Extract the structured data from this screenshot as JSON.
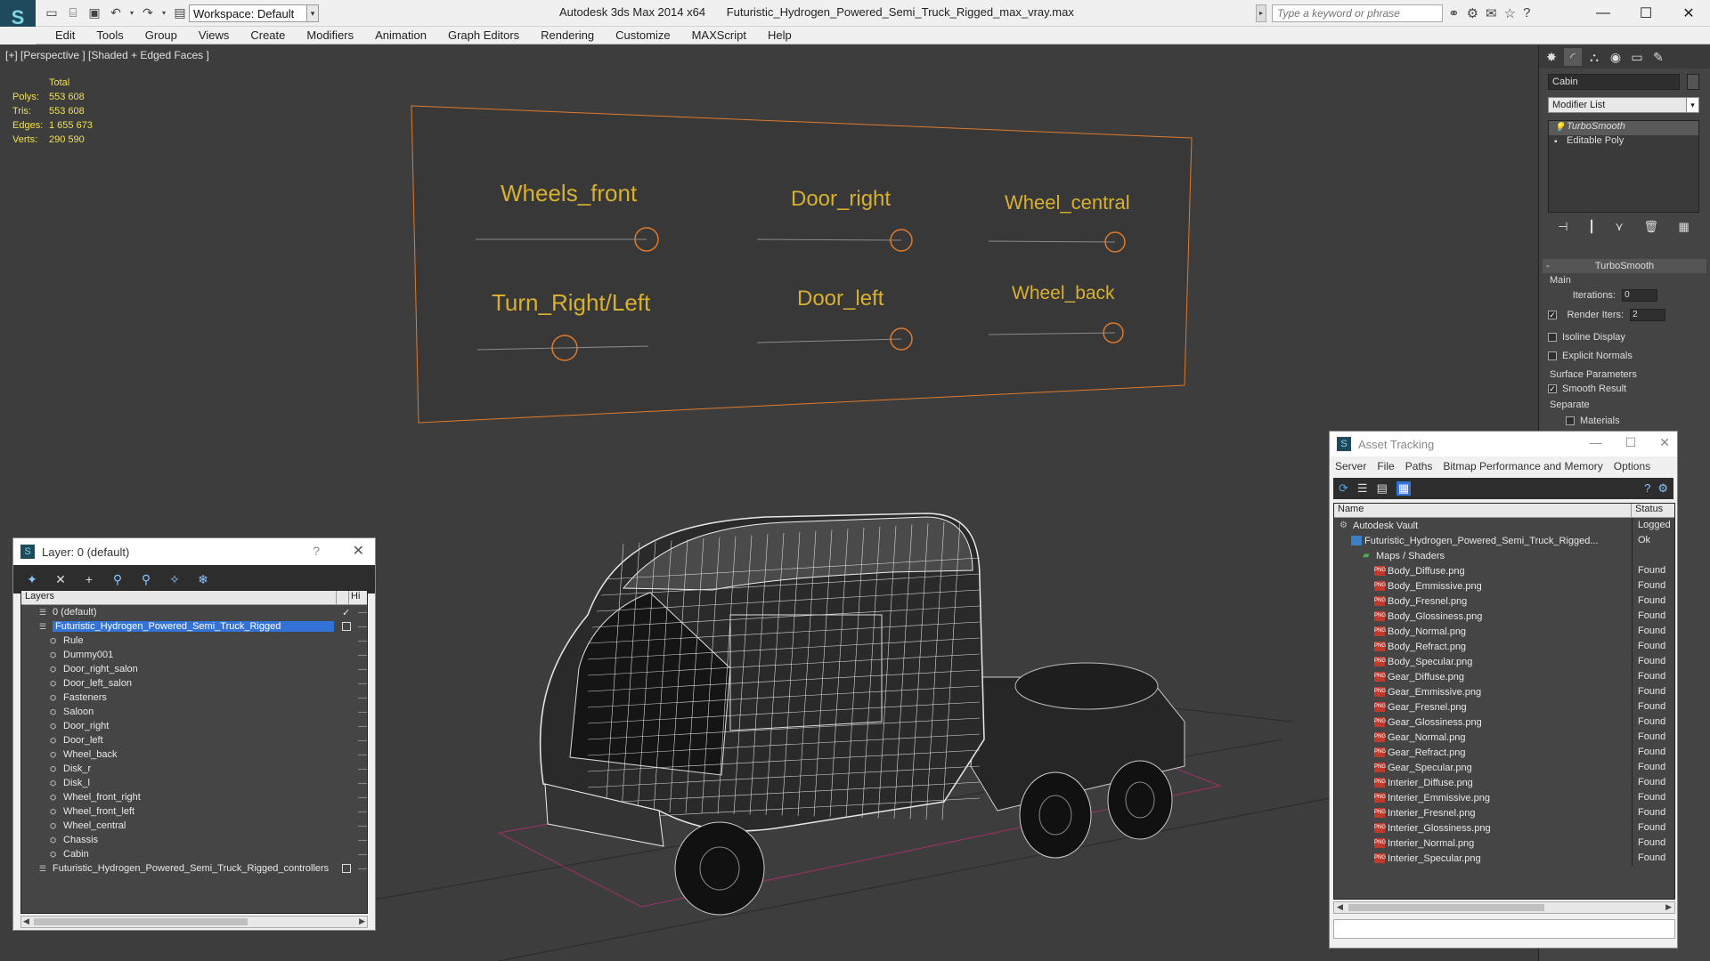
{
  "app": {
    "logo": "S",
    "workspace": "Workspace: Default",
    "title_app": "Autodesk 3ds Max  2014 x64",
    "title_file": "Futuristic_Hydrogen_Powered_Semi_Truck_Rigged_max_vray.max",
    "search_placeholder": "Type a keyword or phrase"
  },
  "menu": [
    "Edit",
    "Tools",
    "Group",
    "Views",
    "Create",
    "Modifiers",
    "Animation",
    "Graph Editors",
    "Rendering",
    "Customize",
    "MAXScript",
    "Help"
  ],
  "viewport": {
    "label": "[+] [Perspective ] [Shaded + Edged Faces ]",
    "stats": {
      "header": "Total",
      "rows": [
        {
          "label": "Polys:",
          "value": "553 608"
        },
        {
          "label": "Tris:",
          "value": "553 608"
        },
        {
          "label": "Edges:",
          "value": "1 655 673"
        },
        {
          "label": "Verts:",
          "value": "290 590"
        }
      ]
    },
    "controls": [
      "Wheels_front",
      "Door_right",
      "Wheel_central",
      "Turn_Right/Left",
      "Door_left",
      "Wheel_back"
    ]
  },
  "layer_dialog": {
    "title": "Layer: 0 (default)",
    "help": "?",
    "col_layers": "Layers",
    "col_hide": "Hi",
    "rows": [
      {
        "name": "0 (default)",
        "level": 0,
        "check": "✓"
      },
      {
        "name": "Futuristic_Hydrogen_Powered_Semi_Truck_Rigged",
        "level": 0,
        "selected": true
      },
      {
        "name": "Rule",
        "level": 1
      },
      {
        "name": "Dummy001",
        "level": 1
      },
      {
        "name": "Door_right_salon",
        "level": 1
      },
      {
        "name": "Door_left_salon",
        "level": 1
      },
      {
        "name": "Fasteners",
        "level": 1
      },
      {
        "name": "Saloon",
        "level": 1
      },
      {
        "name": "Door_right",
        "level": 1
      },
      {
        "name": "Door_left",
        "level": 1
      },
      {
        "name": "Wheel_back",
        "level": 1
      },
      {
        "name": "Disk_r",
        "level": 1
      },
      {
        "name": "Disk_l",
        "level": 1
      },
      {
        "name": "Wheel_front_right",
        "level": 1
      },
      {
        "name": "Wheel_front_left",
        "level": 1
      },
      {
        "name": "Wheel_central",
        "level": 1
      },
      {
        "name": "Chassis",
        "level": 1
      },
      {
        "name": "Cabin",
        "level": 1
      },
      {
        "name": "Futuristic_Hydrogen_Powered_Semi_Truck_Rigged_controllers",
        "level": 0
      }
    ]
  },
  "command_panel": {
    "object_name": "Cabin",
    "modifier_list": "Modifier List",
    "stack": [
      "TurboSmooth",
      "Editable Poly"
    ],
    "rollout": "TurboSmooth",
    "main_label": "Main",
    "iterations_label": "Iterations:",
    "iterations_value": "0",
    "render_iters_label": "Render Iters:",
    "render_iters_value": "2",
    "isoline": "Isoline Display",
    "explicit_normals": "Explicit Normals",
    "surface_params": "Surface Parameters",
    "smooth_result": "Smooth Result",
    "separate": "Separate",
    "materials": "Materials"
  },
  "asset_dialog": {
    "title": "Asset Tracking",
    "menu": [
      "Server",
      "File",
      "Paths",
      "Bitmap Performance and Memory",
      "Options"
    ],
    "col_name": "Name",
    "col_status": "Status",
    "rows": [
      {
        "name": "Autodesk Vault",
        "status": "Logged",
        "type": "vault",
        "indent": 0
      },
      {
        "name": "Futuristic_Hydrogen_Powered_Semi_Truck_Rigged...",
        "status": "Ok",
        "type": "max",
        "indent": 1
      },
      {
        "name": "Maps / Shaders",
        "status": "",
        "type": "folder",
        "indent": 2
      },
      {
        "name": "Body_Diffuse.png",
        "status": "Found",
        "type": "png",
        "indent": 3
      },
      {
        "name": "Body_Emmissive.png",
        "status": "Found",
        "type": "png",
        "indent": 3
      },
      {
        "name": "Body_Fresnel.png",
        "status": "Found",
        "type": "png",
        "indent": 3
      },
      {
        "name": "Body_Glossiness.png",
        "status": "Found",
        "type": "png",
        "indent": 3
      },
      {
        "name": "Body_Normal.png",
        "status": "Found",
        "type": "png",
        "indent": 3
      },
      {
        "name": "Body_Refract.png",
        "status": "Found",
        "type": "png",
        "indent": 3
      },
      {
        "name": "Body_Specular.png",
        "status": "Found",
        "type": "png",
        "indent": 3
      },
      {
        "name": "Gear_Diffuse.png",
        "status": "Found",
        "type": "png",
        "indent": 3
      },
      {
        "name": "Gear_Emmissive.png",
        "status": "Found",
        "type": "png",
        "indent": 3
      },
      {
        "name": "Gear_Fresnel.png",
        "status": "Found",
        "type": "png",
        "indent": 3
      },
      {
        "name": "Gear_Glossiness.png",
        "status": "Found",
        "type": "png",
        "indent": 3
      },
      {
        "name": "Gear_Normal.png",
        "status": "Found",
        "type": "png",
        "indent": 3
      },
      {
        "name": "Gear_Refract.png",
        "status": "Found",
        "type": "png",
        "indent": 3
      },
      {
        "name": "Gear_Specular.png",
        "status": "Found",
        "type": "png",
        "indent": 3
      },
      {
        "name": "Interier_Diffuse.png",
        "status": "Found",
        "type": "png",
        "indent": 3
      },
      {
        "name": "Interier_Emmissive.png",
        "status": "Found",
        "type": "png",
        "indent": 3
      },
      {
        "name": "Interier_Fresnel.png",
        "status": "Found",
        "type": "png",
        "indent": 3
      },
      {
        "name": "Interier_Glossiness.png",
        "status": "Found",
        "type": "png",
        "indent": 3
      },
      {
        "name": "Interier_Normal.png",
        "status": "Found",
        "type": "png",
        "indent": 3
      },
      {
        "name": "Interier_Specular.png",
        "status": "Found",
        "type": "png",
        "indent": 3
      }
    ]
  },
  "colors": {
    "stats_text": "#f0e050",
    "control_orange": "#e07a2a",
    "control_text": "#d8b030",
    "selection_blue": "#3372d6"
  }
}
